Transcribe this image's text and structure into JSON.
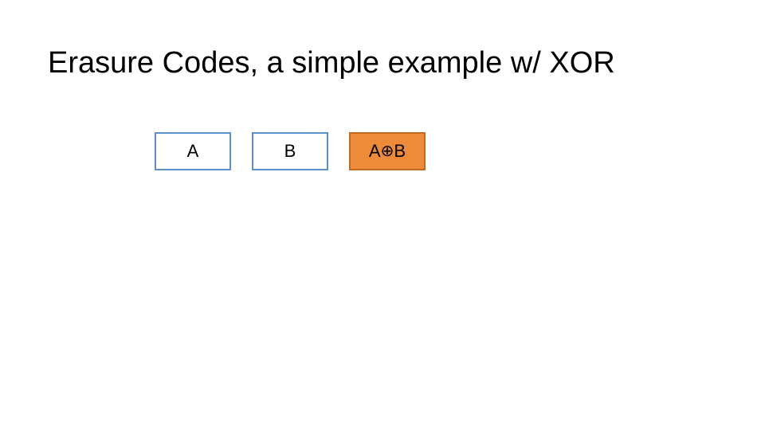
{
  "title": "Erasure Codes, a simple example w/ XOR",
  "blocks": {
    "a": "A",
    "b": "B",
    "parity_pre": "A",
    "parity_op": "⊕",
    "parity_post": "B"
  }
}
